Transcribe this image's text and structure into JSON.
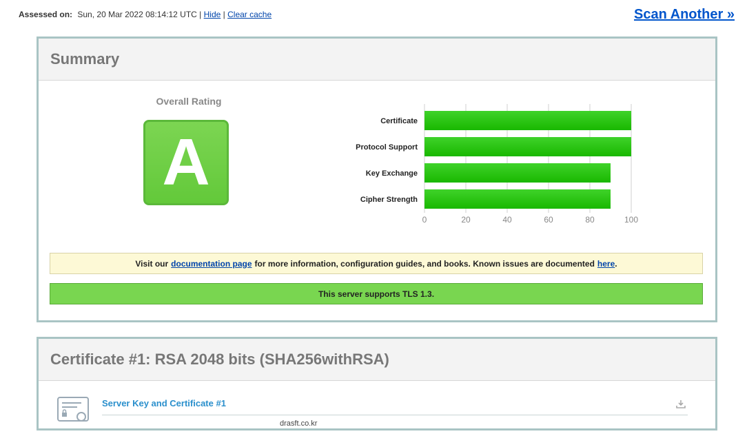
{
  "header": {
    "assessed_label": "Assessed on:",
    "assessed_date": "Sun, 20 Mar 2022 08:14:12 UTC",
    "sep1": "|",
    "hide_link": "Hide",
    "sep2": "|",
    "clear_cache_link": "Clear cache",
    "scan_another": "Scan Another »"
  },
  "summary": {
    "title": "Summary",
    "overall_label": "Overall Rating",
    "grade": "A",
    "grade_color": "#63c93a",
    "doc_note": {
      "prefix": "Visit our",
      "doc_link": "documentation page",
      "middle": "for more information, configuration guides, and books. Known issues are documented",
      "here_link": "here",
      "suffix": "."
    },
    "tls_note": "This server supports TLS 1.3."
  },
  "chart_data": {
    "type": "bar",
    "orientation": "horizontal",
    "categories": [
      "Certificate",
      "Protocol Support",
      "Key Exchange",
      "Cipher Strength"
    ],
    "values": [
      100,
      100,
      90,
      90
    ],
    "xlim": [
      0,
      100
    ],
    "ticks": [
      0,
      20,
      40,
      60,
      80,
      100
    ],
    "grid": true,
    "bar_color": "#19b800"
  },
  "certificate": {
    "title": "Certificate #1: RSA 2048 bits (SHA256withRSA)",
    "subsection": "Server Key and Certificate #1",
    "cut_text": "drasft.co.kr"
  }
}
